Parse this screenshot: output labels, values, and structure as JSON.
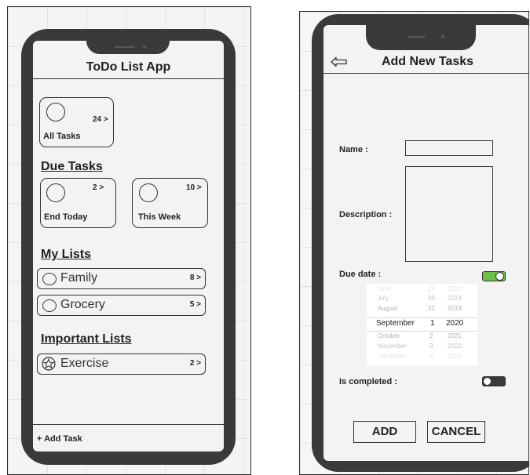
{
  "left_phone": {
    "title": "ToDo List App",
    "all_tasks": {
      "label": "All Tasks",
      "count": "24 >"
    },
    "due_tasks": {
      "heading": "Due Tasks",
      "end_today": {
        "label": "End Today",
        "count": "2 >"
      },
      "this_week": {
        "label": "This Week",
        "count": "10 >"
      }
    },
    "my_lists": {
      "heading": "My Lists",
      "items": [
        {
          "label": "Family",
          "count": "8 >"
        },
        {
          "label": "Grocery",
          "count": "5 >"
        }
      ]
    },
    "important_lists": {
      "heading": "Important Lists",
      "items": [
        {
          "label": "Exercise",
          "count": "2 >",
          "icon": "star-icon"
        }
      ]
    },
    "add_task_label": "+ Add Task"
  },
  "right_phone": {
    "title": "Add New Tasks",
    "back_icon": "arrow-left-icon",
    "name_label": "Name :",
    "description_label": "Description :",
    "due_date_label": "Due date :",
    "due_date_toggle_on": true,
    "date_picker": {
      "months": [
        "June",
        "July",
        "August",
        "September",
        "October",
        "November",
        "December"
      ],
      "days": [
        "29",
        "30",
        "31",
        "1",
        "2",
        "3",
        "4"
      ],
      "years": [
        "2017",
        "2018",
        "2019",
        "2020",
        "2021",
        "2022",
        "2023"
      ],
      "selected": {
        "month": "September",
        "day": "1",
        "year": "2020"
      }
    },
    "is_completed_label": "Is completed :",
    "is_completed_toggle_on": false,
    "add_button": "ADD",
    "cancel_button": "CANCEL"
  },
  "colors": {
    "toggle_on": "#6cc04a",
    "toggle_off": "#3a3a3a",
    "phone_frame": "#3a3a3a"
  }
}
